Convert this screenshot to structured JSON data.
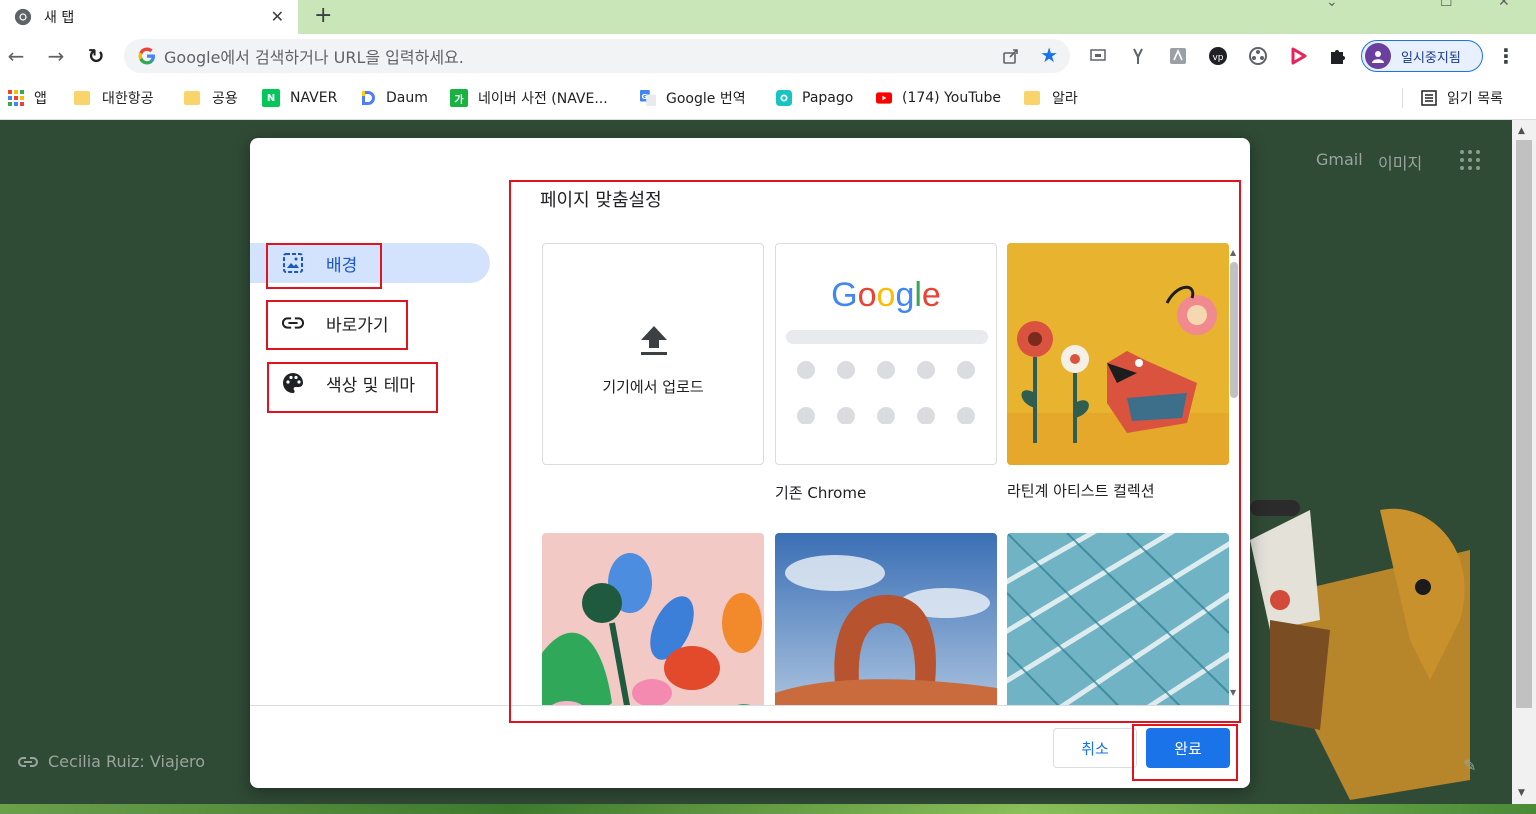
{
  "tab": {
    "title": "새 탭",
    "close": "✕",
    "new_tab": "+"
  },
  "window": {
    "minimize": "⌄",
    "maximize": "☐",
    "close": "✕"
  },
  "toolbar": {
    "back": "←",
    "forward": "→",
    "reload": "↻",
    "omnibox_placeholder": "Google에서 검색하거나 URL을 입력하세요.",
    "star": "★",
    "profile_label": "일시중지됨",
    "menu": "⋮"
  },
  "bookmarks": [
    {
      "label": "앱",
      "icon": "apps-grid-icon"
    },
    {
      "label": "대한항공",
      "icon": "folder-icon"
    },
    {
      "label": "공용",
      "icon": "folder-icon"
    },
    {
      "label": "NAVER",
      "icon": "naver-icon"
    },
    {
      "label": "Daum",
      "icon": "daum-icon"
    },
    {
      "label": "네이버 사전 (NAVE...",
      "icon": "naver-dict-icon"
    },
    {
      "label": "Google 번역",
      "icon": "google-translate-icon"
    },
    {
      "label": "Papago",
      "icon": "papago-icon"
    },
    {
      "label": "(174) YouTube",
      "icon": "youtube-icon"
    },
    {
      "label": "알라",
      "icon": "folder-icon"
    }
  ],
  "reading_list": "읽기 목록",
  "ntp": {
    "gmail": "Gmail",
    "images": "이미지",
    "attribution": "Cecilia Ruiz: Viajero"
  },
  "dialog": {
    "title": "페이지 맞춤설정",
    "sidebar": [
      {
        "label": "배경",
        "icon": "image-icon",
        "active": true
      },
      {
        "label": "바로가기",
        "icon": "link-icon",
        "active": false
      },
      {
        "label": "색상 및 테마",
        "icon": "palette-icon",
        "active": false
      }
    ],
    "tiles": {
      "upload_label": "기기에서 업로드",
      "classic_label": "기존 Chrome",
      "classic_logo": "Google",
      "latin_label": "라틴계 아티스트 컬렉션"
    },
    "cancel": "취소",
    "done": "완료"
  },
  "colors": {
    "accent": "#1a73e8",
    "active_nav_bg": "#d3e3fd",
    "page_bg": "#2f4a35",
    "annotation_red": "#e0141e"
  }
}
